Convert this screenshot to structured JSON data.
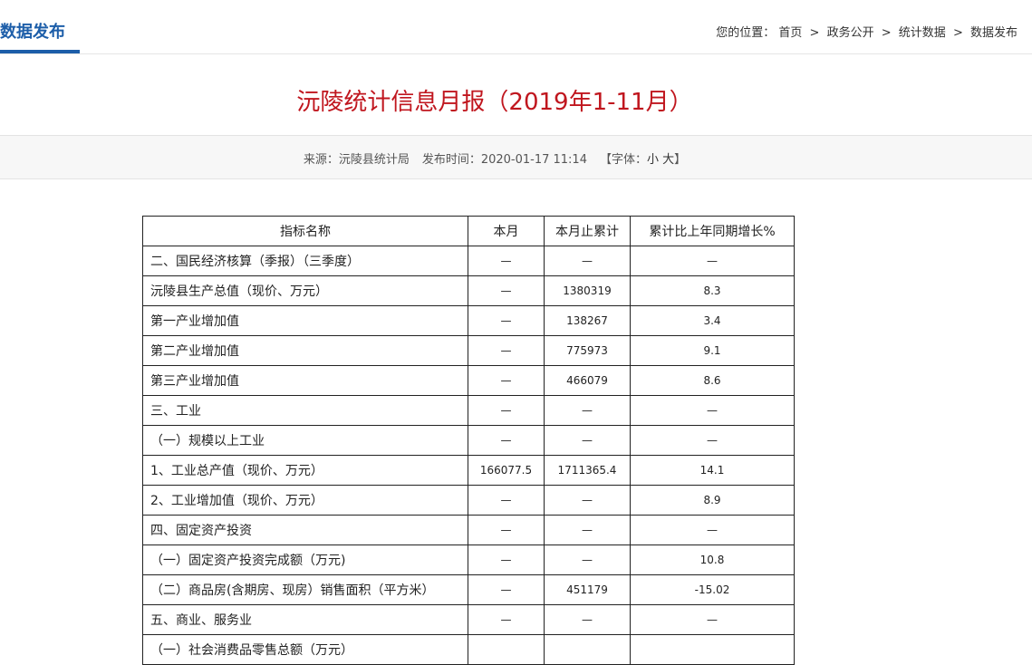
{
  "header": {
    "section_title": "数据发布",
    "breadcrumb": {
      "label": "您的位置：",
      "items": [
        "首页",
        "政务公开",
        "统计数据",
        "数据发布"
      ],
      "separator": ">"
    }
  },
  "article": {
    "title": "沅陵统计信息月报（2019年1-11月）",
    "source": "来源：沅陵县统计局",
    "published": "发布时间：2020-01-17 11:14",
    "font_size": {
      "prefix": "【字体：",
      "small": "小",
      "large": "大",
      "suffix": "】"
    }
  },
  "table": {
    "headers": [
      "指标名称",
      "本月",
      "本月止累计",
      "累计比上年同期增长%"
    ],
    "rows": [
      [
        "二、国民经济核算（季报）（三季度）",
        "—",
        "—",
        "—"
      ],
      [
        "沅陵县生产总值（现价、万元）",
        "—",
        "1380319",
        "8.3"
      ],
      [
        "第一产业增加值",
        "—",
        "138267",
        "3.4"
      ],
      [
        "第二产业增加值",
        "—",
        "775973",
        "9.1"
      ],
      [
        "第三产业增加值",
        "—",
        "466079",
        "8.6"
      ],
      [
        "三、工业",
        "—",
        "—",
        "—"
      ],
      [
        "（一）规模以上工业",
        "—",
        "—",
        "—"
      ],
      [
        "1、工业总产值（现价、万元）",
        "166077.5",
        "1711365.4",
        "14.1"
      ],
      [
        "2、工业增加值（现价、万元）",
        "—",
        "—",
        "8.9"
      ],
      [
        "四、固定资产投资",
        "—",
        "—",
        "—"
      ],
      [
        "（一）固定资产投资完成额（万元)",
        "—",
        "—",
        "10.8"
      ],
      [
        "（二）商品房(含期房、现房）销售面积（平方米）",
        "—",
        "451179",
        "-15.02"
      ],
      [
        "五、商业、服务业",
        "—",
        "—",
        "—"
      ],
      [
        "（一）社会消费品零售总额（万元）",
        "",
        "",
        ""
      ]
    ]
  },
  "colors": {
    "accent": "#1d5ea9",
    "title_red": "#c0161e",
    "meta_bg": "#f7f7f7"
  }
}
